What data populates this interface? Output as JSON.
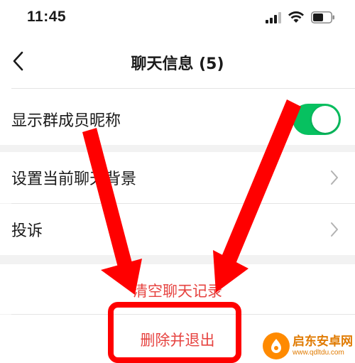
{
  "status_bar": {
    "time": "11:45",
    "icons": [
      "signal-icon",
      "wifi-icon",
      "battery-icon"
    ]
  },
  "nav": {
    "title": "聊天信息 (5)",
    "back_icon": "chevron-left-icon"
  },
  "settings": {
    "show_nicknames": {
      "label": "显示群成员昵称",
      "enabled": true
    },
    "chat_background": {
      "label": "设置当前聊天背景"
    },
    "complaint": {
      "label": "投诉"
    }
  },
  "actions": {
    "clear_history": "清空聊天记录",
    "delete_and_exit": "删除并退出"
  },
  "watermark": {
    "name": "启东安卓网",
    "url": "www.qdltdu.com"
  },
  "colors": {
    "toggle_on": "#07c160",
    "danger_text": "#e64340",
    "annotation_red": "#ff0000",
    "watermark": "#e07a00"
  }
}
